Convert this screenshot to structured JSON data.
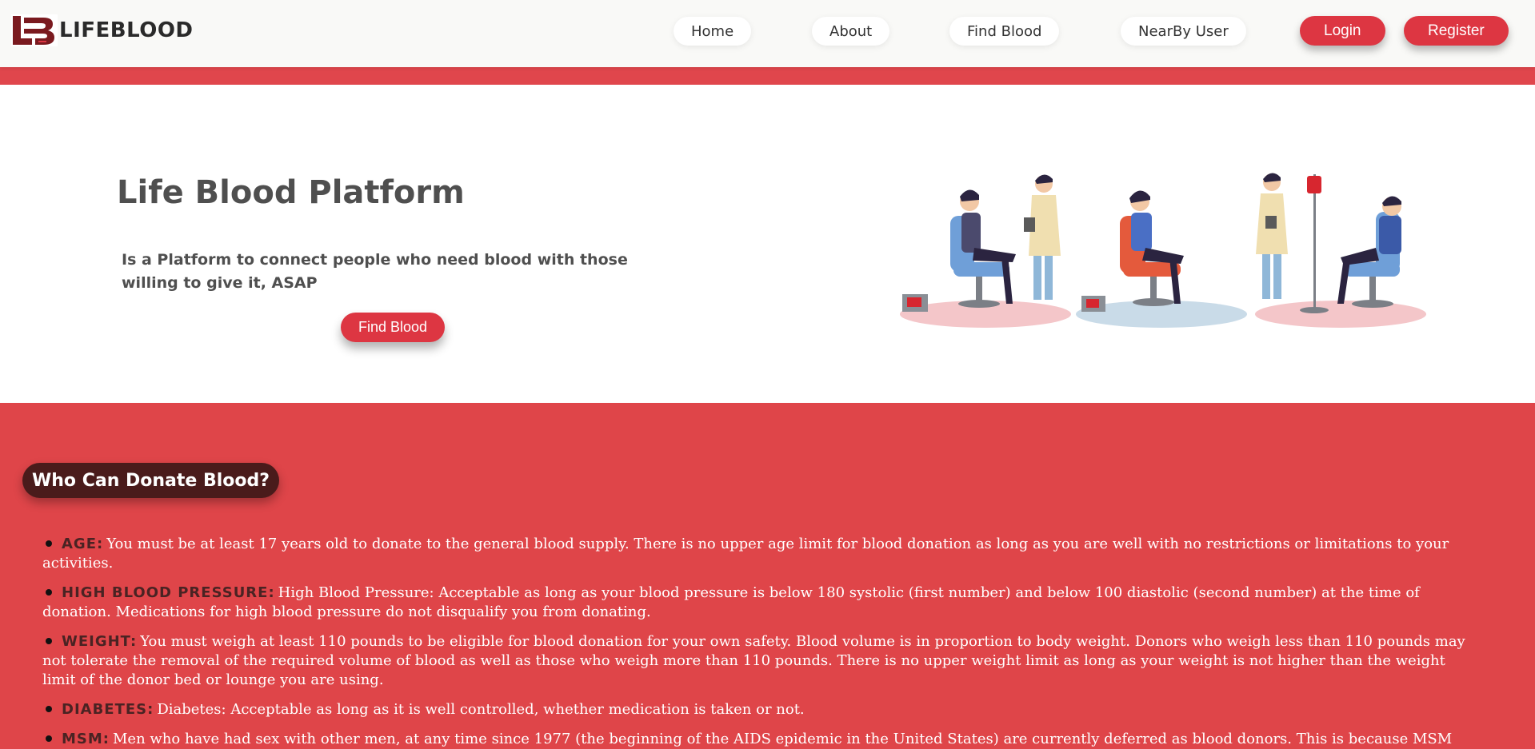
{
  "brand": {
    "name": "LIFEBLOOD"
  },
  "nav": {
    "links": [
      "Home",
      "About",
      "Find Blood",
      "NearBy User"
    ],
    "login": "Login",
    "register": "Register"
  },
  "hero": {
    "title": "Life Blood Platform",
    "subtitle": "Is a Platform to connect people who need blood with those willing to give it, ASAP",
    "cta": "Find Blood"
  },
  "info": {
    "heading": "Who Can Donate Blood?",
    "items": [
      {
        "label": "AGE:",
        "text": "You must be at least 17 years old to donate to the general blood supply. There is no upper age limit for blood donation as long as you are well with no restrictions or limitations to your activities."
      },
      {
        "label": "HIGH BLOOD PRESSURE:",
        "text": "High Blood Pressure: Acceptable as long as your blood pressure is below 180 systolic (first number) and below 100 diastolic (second number) at the time of donation. Medications for high blood pressure do not disqualify you from donating."
      },
      {
        "label": "WEIGHT:",
        "text": "You must weigh at least 110 pounds to be eligible for blood donation for your own safety. Blood volume is in proportion to body weight. Donors who weigh less than 110 pounds may not tolerate the removal of the required volume of blood as well as those who weigh more than 110 pounds. There is no upper weight limit as long as your weight is not higher than the weight limit of the donor bed or lounge you are using."
      },
      {
        "label": "DIABETES:",
        "text": "Diabetes: Acceptable as long as it is well controlled, whether medication is taken or not."
      },
      {
        "label": "MSM:",
        "text": "Men who have had sex with other men, at any time since 1977 (the beginning of the AIDS epidemic in the United States) are currently deferred as blood donors. This is because MSM are, as a group, at increased risk for HIV, hepatitis B and certain other infections that can be transmitted by transfusion."
      }
    ]
  },
  "colors": {
    "accent": "#dd3642",
    "section_bg": "#df4549",
    "heading_pill": "#4a1b1b",
    "text_dark": "#4f4f4f"
  },
  "icons": [
    "lifeblood-logo-icon",
    "blood-donation-illustration"
  ]
}
